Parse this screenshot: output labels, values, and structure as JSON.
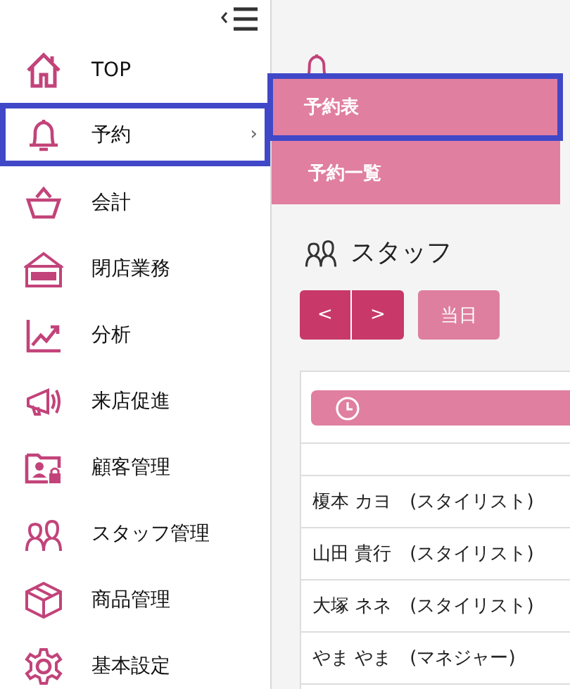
{
  "sidebar": {
    "items": [
      {
        "label": "TOP",
        "selected": false
      },
      {
        "label": "予約",
        "selected": true,
        "chevron": "›"
      },
      {
        "label": "会計",
        "selected": false
      },
      {
        "label": "閉店業務",
        "selected": false
      },
      {
        "label": "分析",
        "selected": false
      },
      {
        "label": "来店促進",
        "selected": false
      },
      {
        "label": "顧客管理",
        "selected": false
      },
      {
        "label": "スタッフ管理",
        "selected": false
      },
      {
        "label": "商品管理",
        "selected": false
      },
      {
        "label": "基本設定",
        "selected": false
      }
    ]
  },
  "submenu": {
    "items": [
      {
        "label": "予約表",
        "selected": true
      },
      {
        "label": "予約一覧",
        "selected": false
      }
    ]
  },
  "page": {
    "section": "スタッフ",
    "buttons": [
      {
        "label": "<",
        "kind": "nav"
      },
      {
        "label": ">",
        "kind": "nav"
      },
      {
        "label": "当日",
        "kind": "today"
      }
    ],
    "staff_rows": [
      "榎本 カヨ　(スタイリスト)",
      "山田 貴行　(スタイリスト)",
      "大塚 ネネ　(スタイリスト)",
      "やま やま　(マネジャー)"
    ]
  }
}
